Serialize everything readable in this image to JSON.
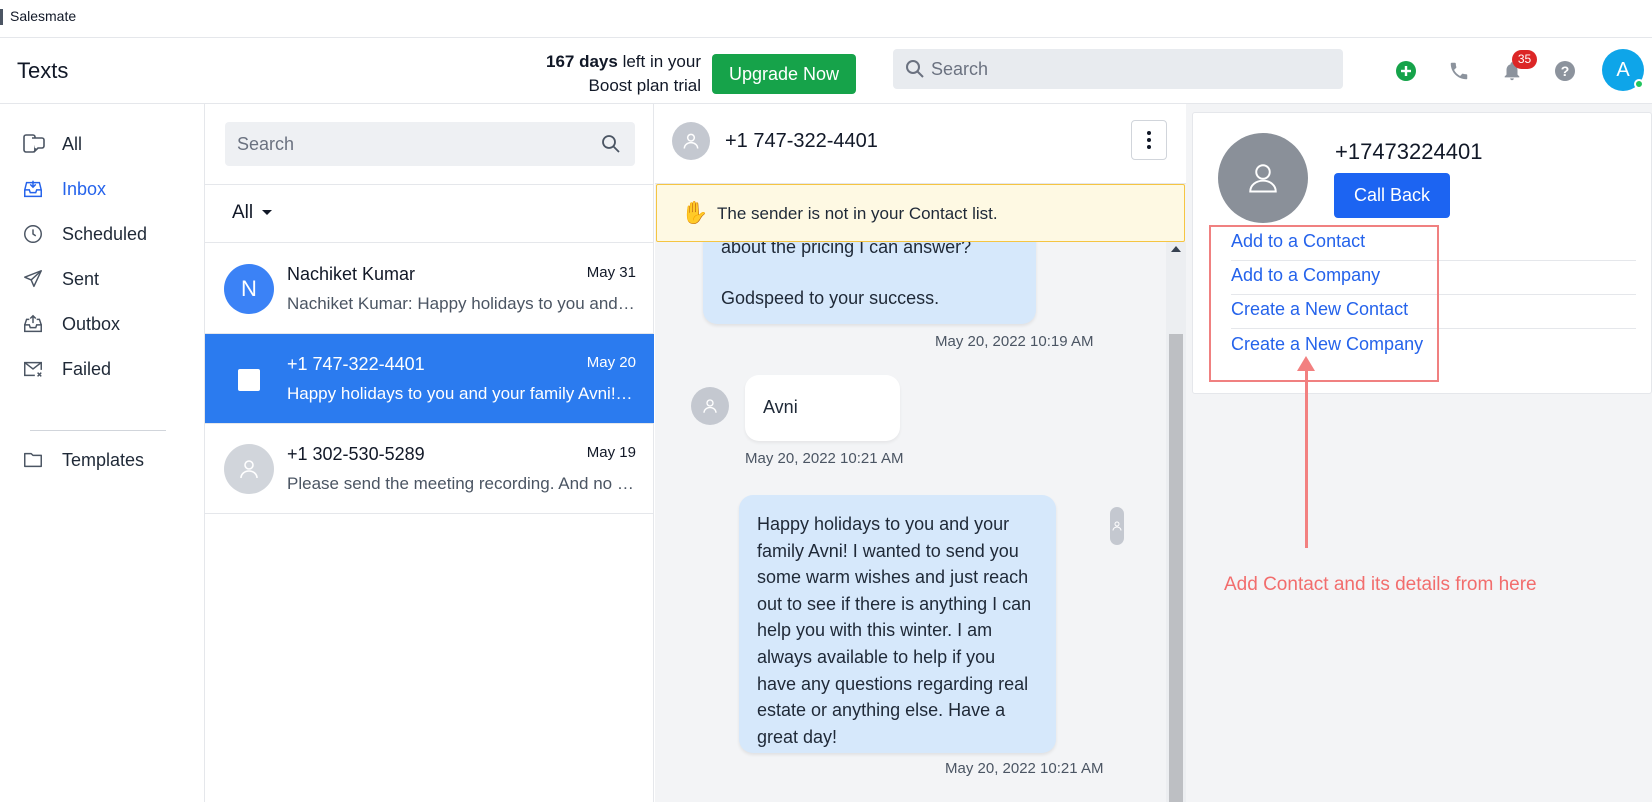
{
  "window": {
    "title": "Salesmate"
  },
  "header": {
    "page_title": "Texts",
    "trial_days": "167 days",
    "trial_rest": "left in your",
    "trial_line2": "Boost plan trial",
    "upgrade_label": "Upgrade Now",
    "search_placeholder": "Search",
    "notification_count": "35",
    "avatar_initial": "A"
  },
  "sidebar": {
    "items": [
      {
        "label": "All",
        "icon": "chat-icon"
      },
      {
        "label": "Inbox",
        "icon": "inbox-icon"
      },
      {
        "label": "Scheduled",
        "icon": "clock-icon"
      },
      {
        "label": "Sent",
        "icon": "send-icon"
      },
      {
        "label": "Outbox",
        "icon": "outbox-icon"
      },
      {
        "label": "Failed",
        "icon": "failed-icon"
      }
    ],
    "templates_label": "Templates"
  },
  "conversations": {
    "search_placeholder": "Search",
    "filter_label": "All",
    "items": [
      {
        "initial": "N",
        "name": "Nachiket Kumar",
        "date": "May 31",
        "preview": "Nachiket Kumar: Happy holidays to you and your family Nachiket!"
      },
      {
        "name": "+1 747-322-4401",
        "date": "May 20",
        "preview": "Happy holidays to you and your family Avni! I wanted to send you"
      },
      {
        "name": "+1 302-530-5289",
        "date": "May 19",
        "preview": "Please send the meeting recording. And no changes required."
      }
    ]
  },
  "thread": {
    "phone": "+1 747-322-4401",
    "banner": "The sender is not in your Contact list.",
    "messages": [
      {
        "text_top": "about the pricing I can answer?",
        "text_bottom": "Godspeed to your success.",
        "time": "May 20, 2022 10:19 AM"
      },
      {
        "text": "Avni",
        "time": "May 20, 2022 10:21 AM"
      },
      {
        "text": "Happy holidays to you and your family Avni! I wanted to send you some warm wishes and just reach out to see if there is anything I can help you with this winter. I am always available to help if you have any questions regarding real estate or anything else. Have a great day!",
        "time": "May 20, 2022 10:21 AM"
      }
    ]
  },
  "contact_panel": {
    "phone": "+17473224401",
    "call_back_label": "Call Back",
    "actions": [
      "Add to a Contact",
      "Add to a Company",
      "Create a New Contact",
      "Create a New Company"
    ],
    "annotation": "Add Contact and its details from here"
  },
  "colors": {
    "accent": "#2b7bef",
    "upgrade": "#16a34a",
    "call_back": "#1c64f2",
    "annotation": "#f26d6d"
  }
}
